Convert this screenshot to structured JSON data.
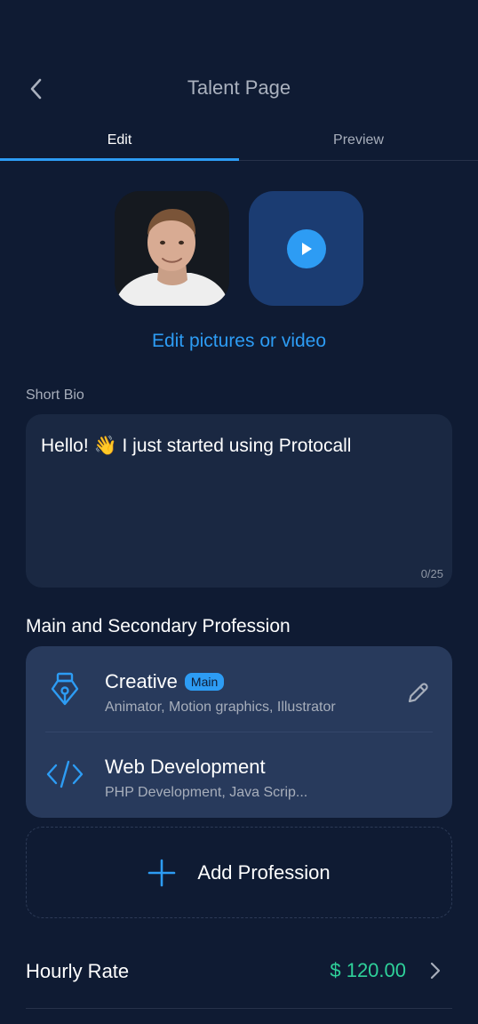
{
  "header": {
    "title": "Talent Page"
  },
  "tabs": [
    {
      "label": "Edit",
      "active": true
    },
    {
      "label": "Preview",
      "active": false
    }
  ],
  "media": {
    "edit_label": "Edit pictures or video"
  },
  "bio": {
    "label": "Short Bio",
    "value": "Hello! 👋 I just started using Protocall",
    "counter": "0/25"
  },
  "profession": {
    "title": "Main and Secondary Profession",
    "items": [
      {
        "name": "Creative",
        "badge": "Main",
        "skills": "Animator, Motion graphics, Illustrator",
        "icon": "pen-nib-icon"
      },
      {
        "name": "Web Development",
        "skills": "PHP Development, Java Scrip...",
        "icon": "code-icon"
      }
    ],
    "add_label": "Add Profession"
  },
  "rate": {
    "label": "Hourly Rate",
    "value": "$ 120.00"
  },
  "colors": {
    "accent": "#2d9cf4",
    "background": "#0f1b33",
    "card": "#283a5c",
    "rate": "#2fd19a"
  }
}
